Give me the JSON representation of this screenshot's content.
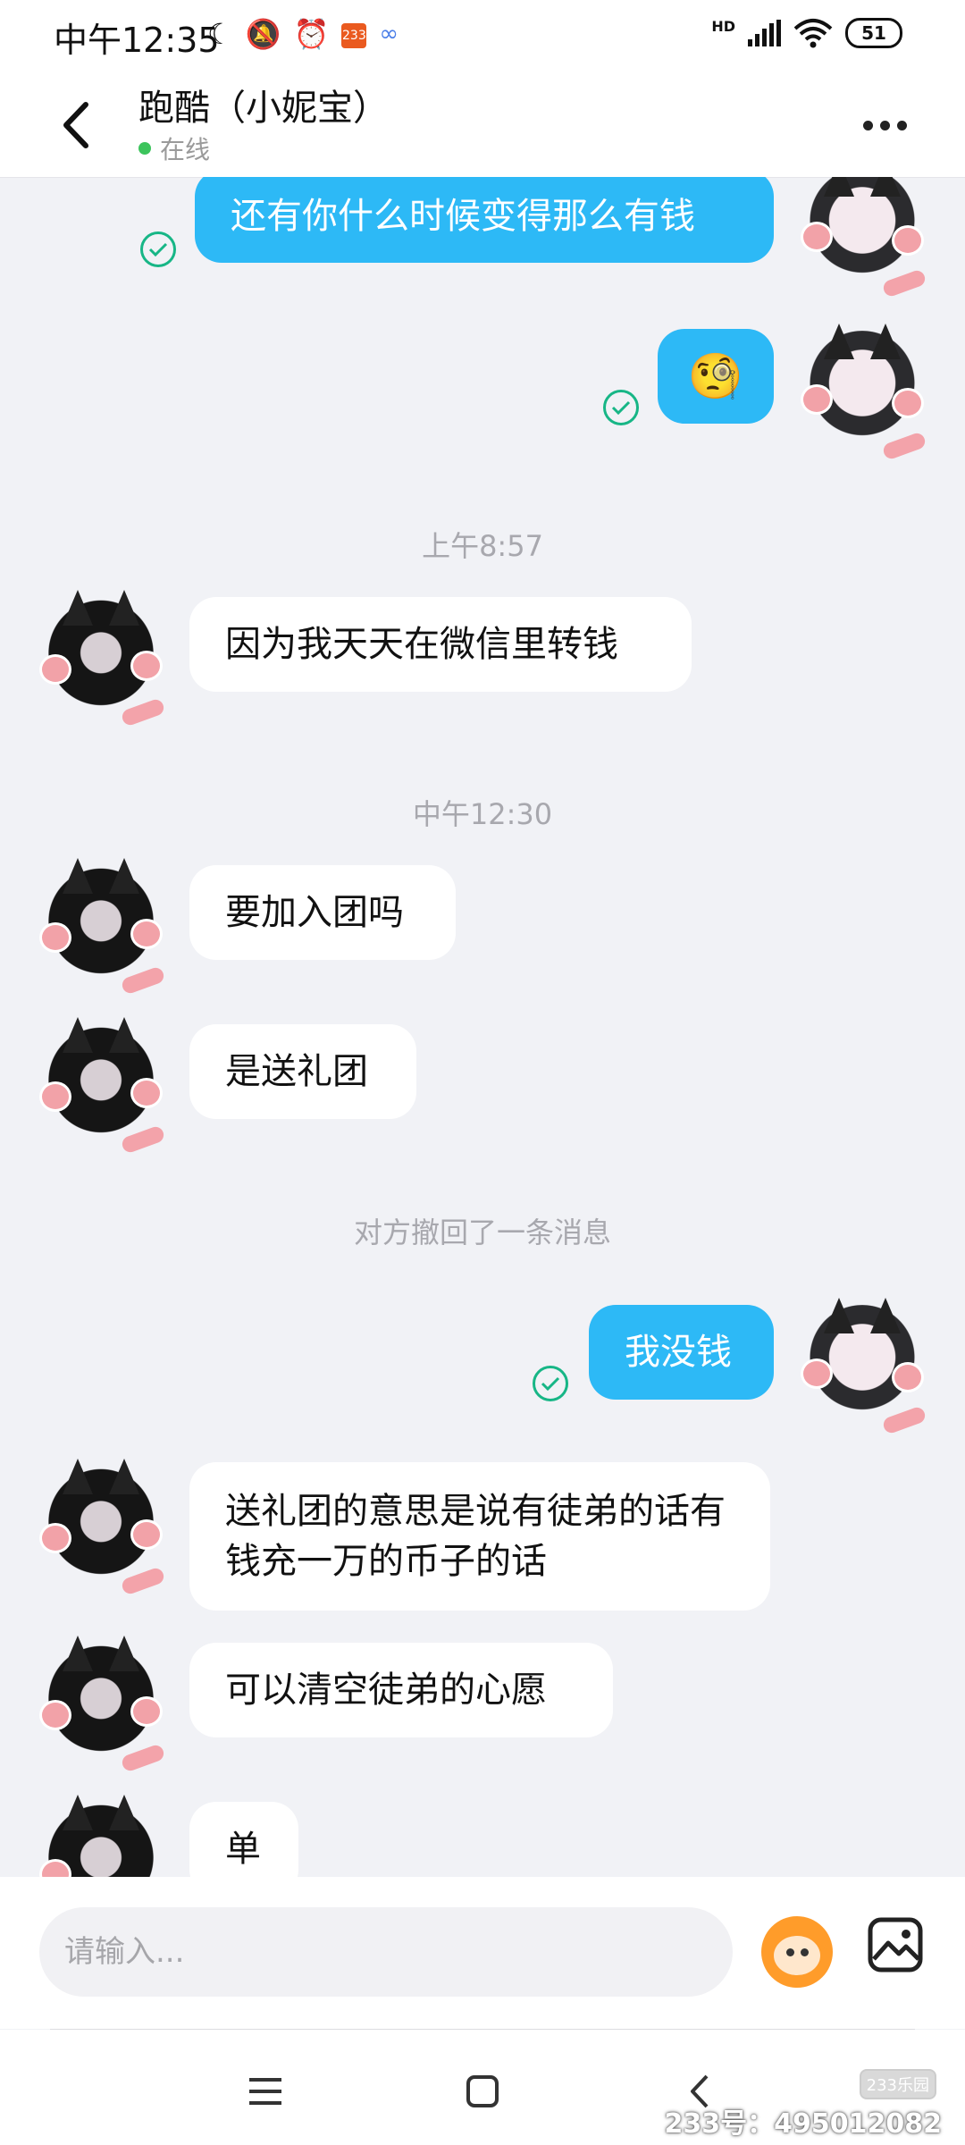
{
  "status_bar": {
    "time": "中午12:35",
    "network": "HD",
    "battery": "51",
    "app_badge": "233"
  },
  "header": {
    "title": "跑酷（小妮宝）",
    "status": "在线"
  },
  "messages": [
    {
      "side": "me",
      "text": "还有你什么时候变得那么有钱"
    },
    {
      "side": "me",
      "text": "🧐"
    },
    {
      "timestamp": "上午8:57"
    },
    {
      "side": "them",
      "text": "因为我天天在微信里转钱"
    },
    {
      "timestamp": "中午12:30"
    },
    {
      "side": "them",
      "text": "要加入团吗"
    },
    {
      "side": "them",
      "text": "是送礼团"
    },
    {
      "notice": "对方撤回了一条消息"
    },
    {
      "side": "me",
      "text": "我没钱"
    },
    {
      "side": "them",
      "text": "送礼团的意思是说有徒弟的话有钱充一万的币子的话"
    },
    {
      "side": "them",
      "text": "可以清空徒弟的心愿"
    },
    {
      "side": "them",
      "text": "单"
    }
  ],
  "input": {
    "placeholder": "请输入..."
  },
  "watermark": {
    "logo": "233乐园",
    "id": "233号：495012082"
  },
  "colors": {
    "my_bubble": "#2db9f6",
    "their_bubble": "#ffffff",
    "background": "#f1f2f6",
    "read_check": "#17b686",
    "online_dot": "#3cc45c"
  },
  "icons": [
    "back-icon",
    "more-icon",
    "read-check-icon",
    "mascot-emoji-icon",
    "image-icon",
    "menu-icon",
    "home-icon",
    "nav-back-icon"
  ]
}
